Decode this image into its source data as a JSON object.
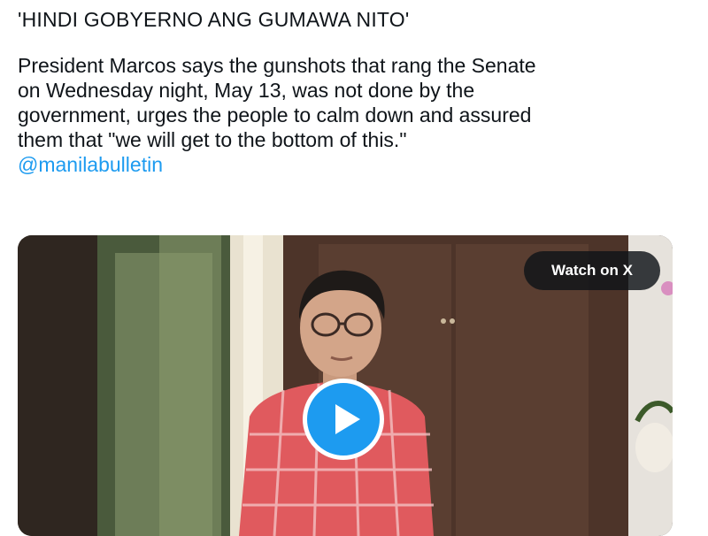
{
  "post": {
    "headline": "'HINDI GOBYERNO ANG GUMAWA NITO'",
    "body_lines": [
      "President Marcos says the gunshots that rang the Senate",
      "on Wednesday night, May 13, was not done by the",
      "government, urges the people to calm down and assured",
      "them that \"we will get to the bottom of this.\""
    ],
    "mention": "@manilabulletin"
  },
  "video": {
    "watch_label": "Watch on X",
    "play_icon": "play-icon"
  },
  "colors": {
    "text": "#0f1419",
    "link": "#1d9bf0",
    "play_button": "#1d9bf0",
    "watch_button_bg": "#0f1419"
  }
}
